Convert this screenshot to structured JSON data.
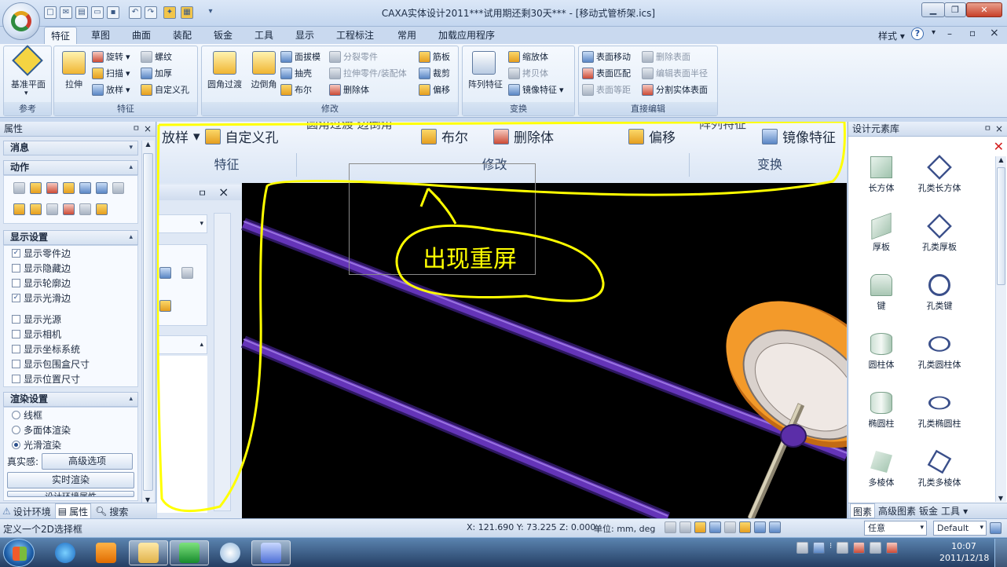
{
  "window": {
    "title": "CAXA实体设计2011***试用期还剩30天*** - [移动式管桥架.ics]",
    "minimize_icon": "minimize-icon",
    "maximize_icon": "restore-icon",
    "close_icon": "close-icon"
  },
  "quick_access": [
    "new-icon",
    "mail-icon",
    "doc-icon",
    "open-icon",
    "save-icon",
    "undo-icon",
    "redo-icon",
    "build-icon",
    "chart-icon",
    "dropdown-icon"
  ],
  "tabs": [
    "特征",
    "草图",
    "曲面",
    "装配",
    "钣金",
    "工具",
    "显示",
    "工程标注",
    "常用",
    "加载应用程序"
  ],
  "active_tab": "特征",
  "top_right": {
    "style_label": "样式",
    "help": "?",
    "min": "–",
    "restore": "▫",
    "close": "×"
  },
  "ribbon": {
    "groups": {
      "ref": {
        "label": "参考",
        "big": "基准平面"
      },
      "feature": {
        "label": "特征",
        "big": "拉伸",
        "items": [
          "旋转",
          "螺纹",
          "扫描",
          "加厚",
          "放样",
          "自定义孔"
        ]
      },
      "modify": {
        "label": "修改",
        "big1": "圆角过渡",
        "big2": "边倒角",
        "items": [
          "面拔模",
          "分裂零件",
          "筋板",
          "抽壳",
          "拉伸零件/装配体",
          "裁剪",
          "布尔",
          "删除体",
          "偏移"
        ]
      },
      "transform": {
        "label": "变换",
        "big": "阵列特征",
        "items": [
          "缩放体",
          "拷贝体",
          "镜像特征"
        ]
      },
      "direct": {
        "label": "直接编辑",
        "items": [
          "表面移动",
          "删除表面",
          "表面匹配",
          "编辑表面半径",
          "表面等距",
          "分割实体表面"
        ]
      }
    }
  },
  "left_panel": {
    "title": "属性",
    "pin": "ㅁ",
    "close": "×",
    "sections": {
      "message": "消息",
      "action": "动作",
      "display": "显示设置",
      "render": "渲染设置"
    },
    "display_options": [
      {
        "label": "显示零件边",
        "checked": true
      },
      {
        "label": "显示隐藏边",
        "checked": false
      },
      {
        "label": "显示轮廓边",
        "checked": false
      },
      {
        "label": "显示光滑边",
        "checked": true
      },
      {
        "label": "显示光源",
        "checked": false
      },
      {
        "label": "显示相机",
        "checked": false
      },
      {
        "label": "显示坐标系统",
        "checked": false
      },
      {
        "label": "显示包围盒尺寸",
        "checked": false
      },
      {
        "label": "显示位置尺寸",
        "checked": false
      }
    ],
    "render_options": [
      {
        "label": "线框",
        "selected": false
      },
      {
        "label": "多面体渲染",
        "selected": false
      },
      {
        "label": "光滑渲染",
        "selected": true
      }
    ],
    "realism_label": "真实感:",
    "advanced_button": "高级选项",
    "realtime_button": "实时渲染",
    "cut_button": "设计环境属性",
    "bottom_tabs": [
      "设计环境",
      "属性",
      "搜索"
    ]
  },
  "overlay": {
    "ribbon_copy": {
      "item1": "放样",
      "item2": "自定义孔",
      "group1": "特征",
      "top_cut": "圆角过渡  边倒角",
      "item3": "布尔",
      "item4": "删除体",
      "item5": "偏移",
      "group2": "修改",
      "top_cut2": "阵列特征",
      "item6": "镜像特征",
      "group3": "变换"
    },
    "annotation": "出现重屏",
    "inner_close": "×",
    "inner_pin": "ㅁ"
  },
  "right_panel": {
    "title": "设计元素库",
    "shapes": [
      "长方体",
      "孔类长方体",
      "厚板",
      "孔类厚板",
      "键",
      "孔类键",
      "圆柱体",
      "孔类圆柱体",
      "椭圆柱",
      "孔类椭圆柱",
      "多棱体",
      "孔类多棱体"
    ],
    "bottom_tabs": [
      "图素",
      "高级图素",
      "钣金",
      "工具"
    ]
  },
  "status_bar": {
    "hint": "定义一个2D选择框",
    "coords": "X: 121.690 Y: 73.225 Z: 0.000",
    "units": "单位: mm, deg",
    "filter": "任意",
    "default": "Default"
  },
  "taskbar": {
    "clock_time": "10:07",
    "clock_date": "2011/12/18",
    "apps": [
      "ie-icon",
      "media-player-icon",
      "explorer-icon",
      "chart-app-icon",
      "network-icon",
      "caxa-icon"
    ]
  },
  "colors": {
    "accent": "#2b4f8c",
    "annotation": "#ffff00",
    "pipe": "#5a2ca0",
    "disc": "#f08a1c"
  }
}
